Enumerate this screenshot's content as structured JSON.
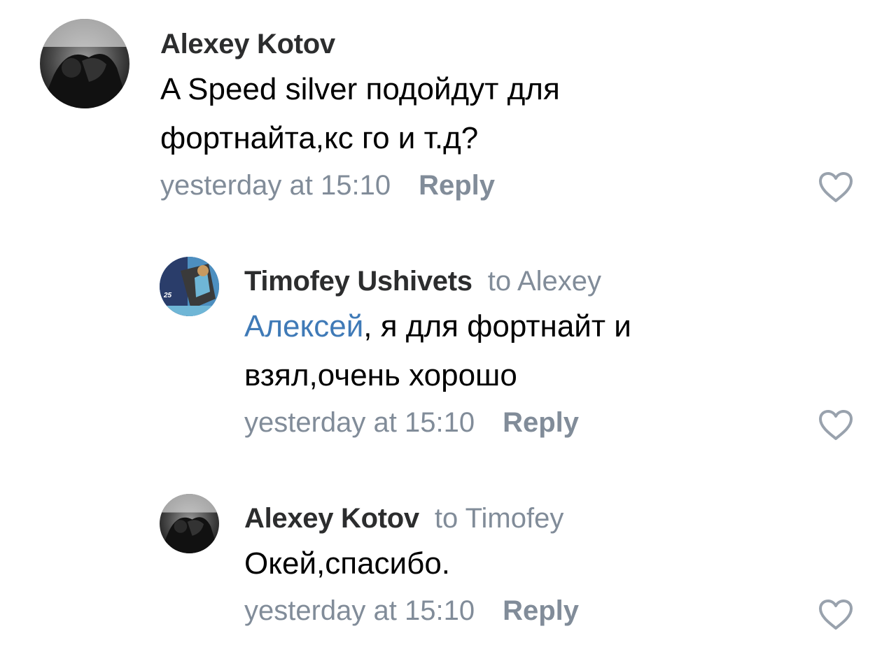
{
  "comments": [
    {
      "author": "Alexey Kotov",
      "reply_to": "",
      "mention": "",
      "text": "A Speed silver подойдут для фортнайта,кс го и т.д?",
      "time": "yesterday at 15:10",
      "reply_label": "Reply"
    },
    {
      "author": "Timofey Ushivets",
      "reply_to": "to Alexey",
      "mention": "Алексей",
      "text": ", я для фортнайт и взял,очень хорошо",
      "time": "yesterday at 15:10",
      "reply_label": "Reply"
    },
    {
      "author": "Alexey Kotov",
      "reply_to": "to Timofey",
      "mention": "",
      "text": "Окей,спасибо.",
      "time": "yesterday at 15:10",
      "reply_label": "Reply"
    }
  ],
  "colors": {
    "meta_gray": "#818c99",
    "link_blue": "#3f7ab7",
    "icon_gray": "#99a2ad"
  },
  "icons": {
    "like": "heart-outline-icon"
  }
}
